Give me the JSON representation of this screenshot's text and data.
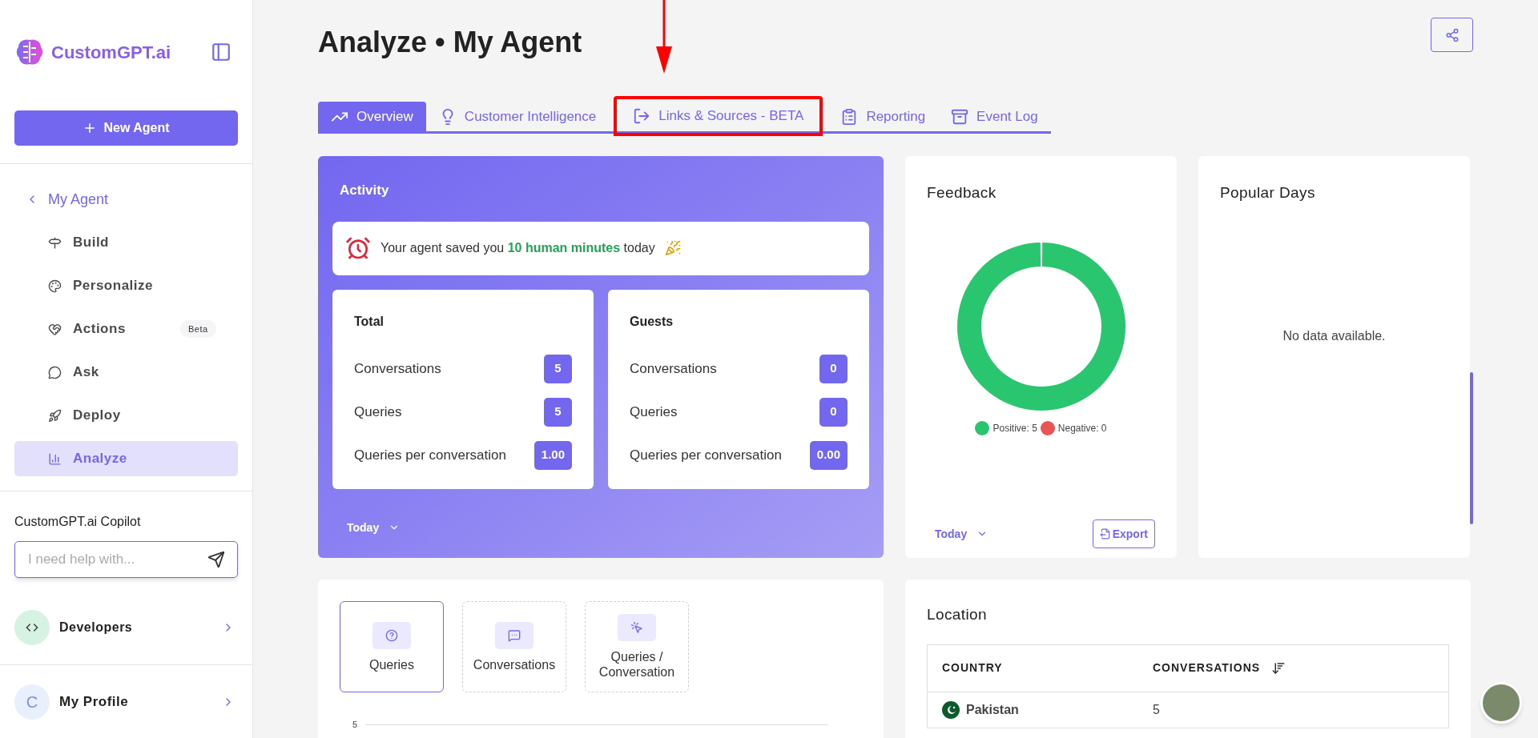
{
  "sidebar": {
    "logo_text": "CustomGPT.ai",
    "new_agent_button": "New Agent",
    "back_link": "My Agent",
    "items": [
      {
        "label": "Build",
        "selected": false
      },
      {
        "label": "Personalize",
        "selected": false
      },
      {
        "label": "Actions",
        "selected": false,
        "badge": "Beta"
      },
      {
        "label": "Ask",
        "selected": false
      },
      {
        "label": "Deploy",
        "selected": false
      },
      {
        "label": "Analyze",
        "selected": true
      }
    ],
    "copilot": {
      "title": "CustomGPT.ai Copilot",
      "placeholder": "I need help with..."
    },
    "developers": "Developers",
    "profile": {
      "initial": "C",
      "label": "My Profile"
    }
  },
  "page": {
    "title": "Analyze • My Agent",
    "tabs": [
      {
        "label": "Overview",
        "selected": true,
        "highlighted": false
      },
      {
        "label": "Customer Intelligence",
        "selected": false,
        "highlighted": false
      },
      {
        "label": "Links & Sources - BETA",
        "selected": false,
        "highlighted": true
      },
      {
        "label": "Reporting",
        "selected": false,
        "highlighted": false
      },
      {
        "label": "Event Log",
        "selected": false,
        "highlighted": false
      }
    ]
  },
  "activity": {
    "title": "Activity",
    "saved_message": "Your agent saved you **10 human minutes** today",
    "groups": [
      {
        "title": "Total",
        "rows": [
          {
            "label": "Conversations",
            "value": "5"
          },
          {
            "label": "Queries",
            "value": "5"
          },
          {
            "label": "Queries per conversation",
            "value": "1.00"
          }
        ]
      },
      {
        "title": "Guests",
        "rows": [
          {
            "label": "Conversations",
            "value": "0"
          },
          {
            "label": "Queries",
            "value": "0"
          },
          {
            "label": "Queries per conversation",
            "value": "0.00"
          }
        ]
      }
    ],
    "period": "Today"
  },
  "feedback": {
    "title": "Feedback",
    "legend": [
      {
        "label": "Positive: 5",
        "color": "#2ac56f"
      },
      {
        "label": "Negative: 0",
        "color": "#ea5455"
      }
    ],
    "period": "Today",
    "export_button": "Export"
  },
  "popular_days": {
    "title": "Popular Days",
    "empty_message": "No data available."
  },
  "metric_selector": {
    "options": [
      {
        "label": "Queries",
        "selected": true
      },
      {
        "label": "Conversations",
        "selected": false
      },
      {
        "label": "Queries / Conversation",
        "selected": false
      }
    ],
    "y_tick": "5"
  },
  "location": {
    "title": "Location",
    "columns": [
      "COUNTRY",
      "CONVERSATIONS"
    ],
    "rows": [
      {
        "country": "Pakistan",
        "conversations": "5"
      }
    ]
  }
}
